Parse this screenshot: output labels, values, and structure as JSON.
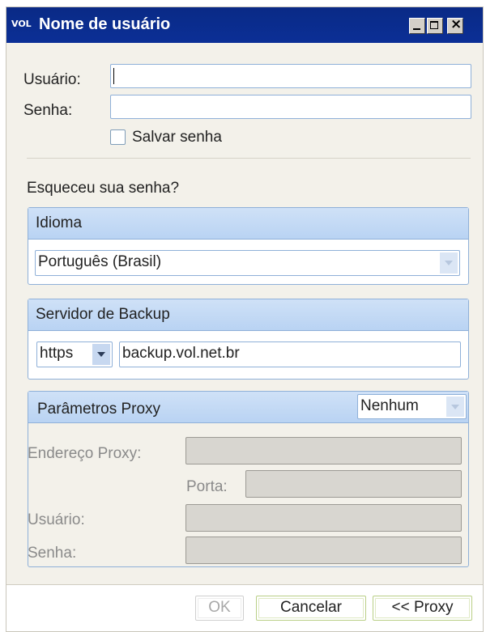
{
  "window": {
    "logo": "VOL",
    "title": "Nome de usuário"
  },
  "login": {
    "user_label": "Usuário:",
    "user_value": "",
    "password_label": "Senha:",
    "password_value": "",
    "save_password_label": "Salvar senha",
    "save_password_checked": false,
    "forgot_password": "Esqueceu sua senha?"
  },
  "language": {
    "title": "Idioma",
    "selected": "Português (Brasil)"
  },
  "backup_server": {
    "title": "Servidor de Backup",
    "protocol": "https",
    "host": "backup.vol.net.br"
  },
  "proxy": {
    "title": "Parâmetros Proxy",
    "mode": "Nenhum",
    "address_label": "Endereço Proxy:",
    "port_label": "Porta:",
    "user_label": "Usuário:",
    "password_label": "Senha:"
  },
  "buttons": {
    "ok": "OK",
    "cancel": "Cancelar",
    "proxy": "<< Proxy"
  },
  "colors": {
    "titlebar": "#0b2f96",
    "panel_header": "#c4daf5",
    "button_border": "#b9cf86"
  }
}
